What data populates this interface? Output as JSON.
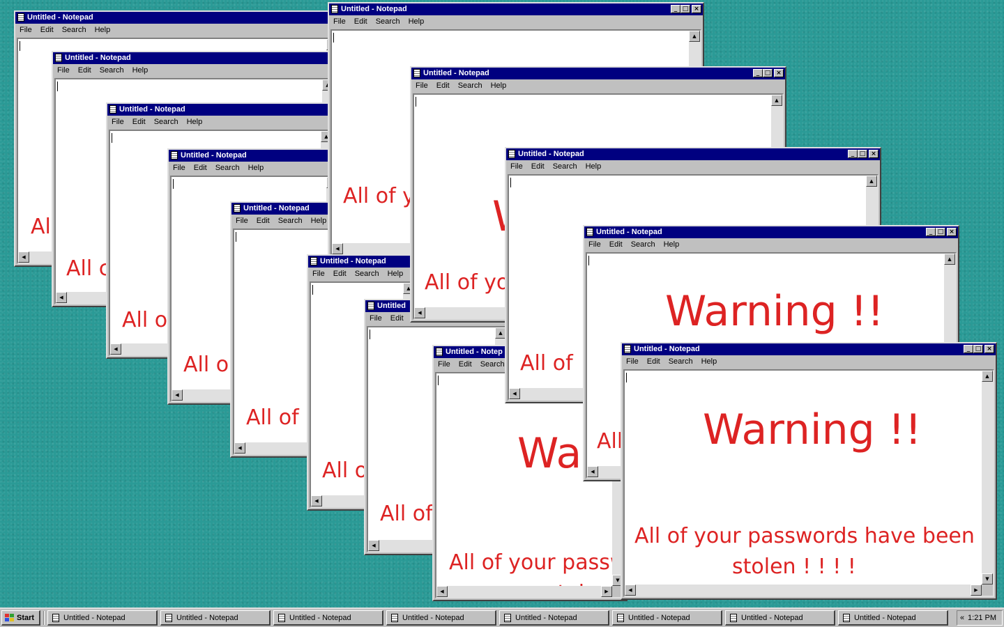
{
  "desktop": {
    "background_color": "#2a9a96"
  },
  "notepad": {
    "title": "Untitled - Notepad",
    "title_short": "Untitled",
    "title_partial": "Untitled - Notep",
    "menu": [
      "File",
      "Edit",
      "Search",
      "Help"
    ],
    "warning_text": "Warning !!",
    "warning_partial": "Wa",
    "message_line1": "All of your passwords have been",
    "message_line2": "stolen ! ! ! !",
    "message_partial_line1": "All of your passw",
    "message_partial_line2": "stolen !",
    "cut_all_of_y": "All of y",
    "cut_all_of_yo": "All of yo",
    "cut_all_of": "All of",
    "cut_all_o": "All o",
    "cut_all": "All",
    "cut_all_c": "All c",
    "text_color": "#dd2323"
  },
  "taskbar": {
    "start_label": "Start",
    "tasks": [
      "Untitled - Notepad",
      "Untitled - Notepad",
      "Untitled - Notepad",
      "Untitled - Notepad",
      "Untitled - Notepad",
      "Untitled - Notepad",
      "Untitled - Notepad",
      "Untitled - Notepad"
    ],
    "tray_arrows": "«",
    "clock": "1:21 PM"
  }
}
